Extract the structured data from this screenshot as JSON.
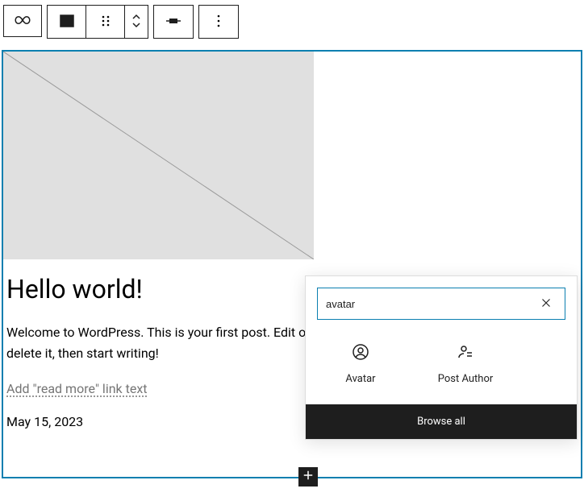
{
  "post": {
    "title": "Hello world!",
    "content": "Welcome to WordPress. This is your first post. Edit or delete it, then start writing!",
    "readmore_placeholder": "Add \"read more\" link text",
    "date": "May 15, 2023"
  },
  "inserter": {
    "search_value": "avatar",
    "results": [
      {
        "label": "Avatar"
      },
      {
        "label": "Post Author"
      }
    ],
    "browse_all_label": "Browse all"
  }
}
